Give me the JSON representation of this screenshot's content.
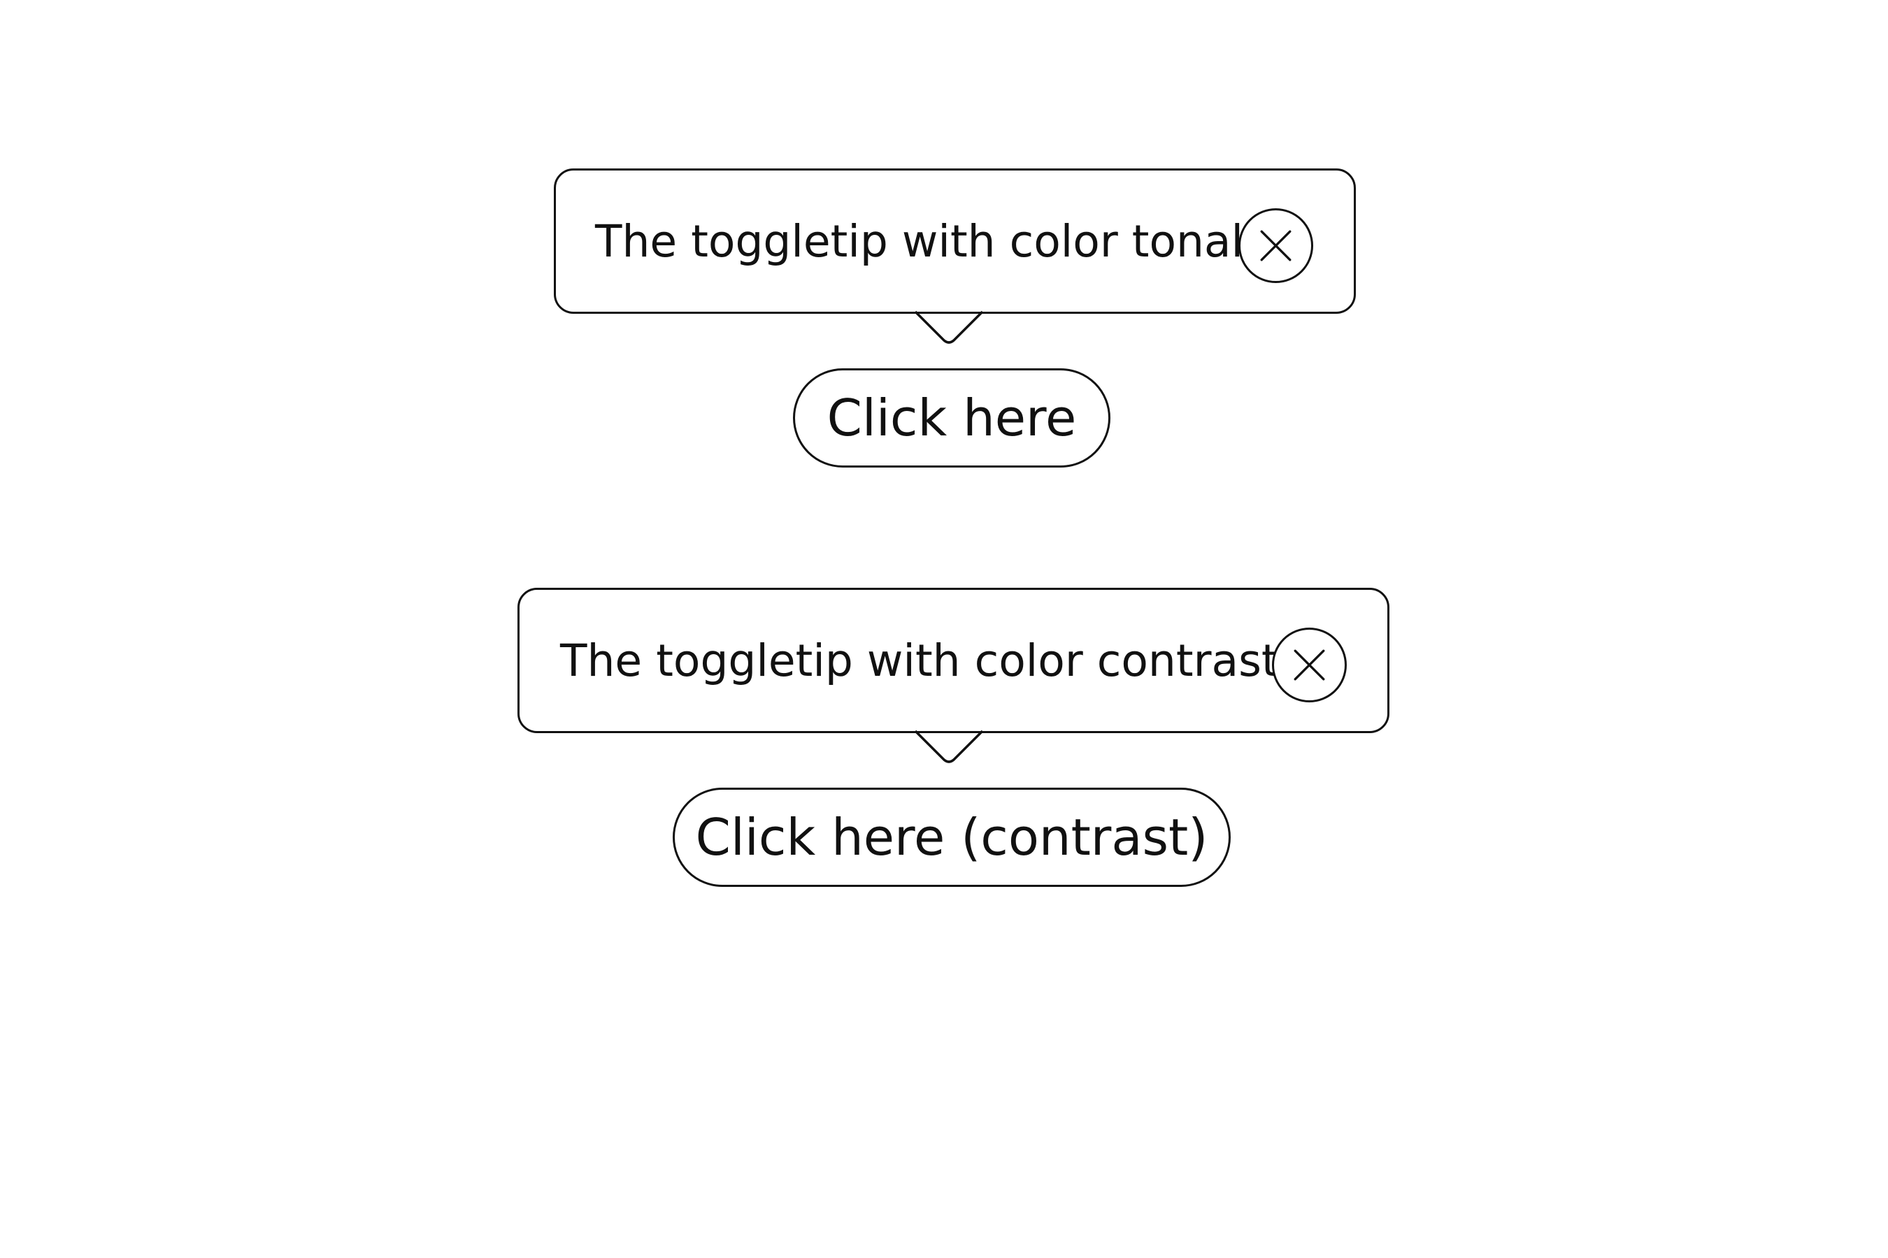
{
  "toggletips": [
    {
      "message": "The toggletip with color tonal.",
      "close_icon": "close-x-icon",
      "trigger_label": "Click here"
    },
    {
      "message": "The toggletip with color contrast.",
      "close_icon": "close-x-icon",
      "trigger_label": "Click here (contrast)"
    }
  ],
  "colors": {
    "outline": "#111111",
    "background": "#ffffff",
    "text": "#111111"
  }
}
